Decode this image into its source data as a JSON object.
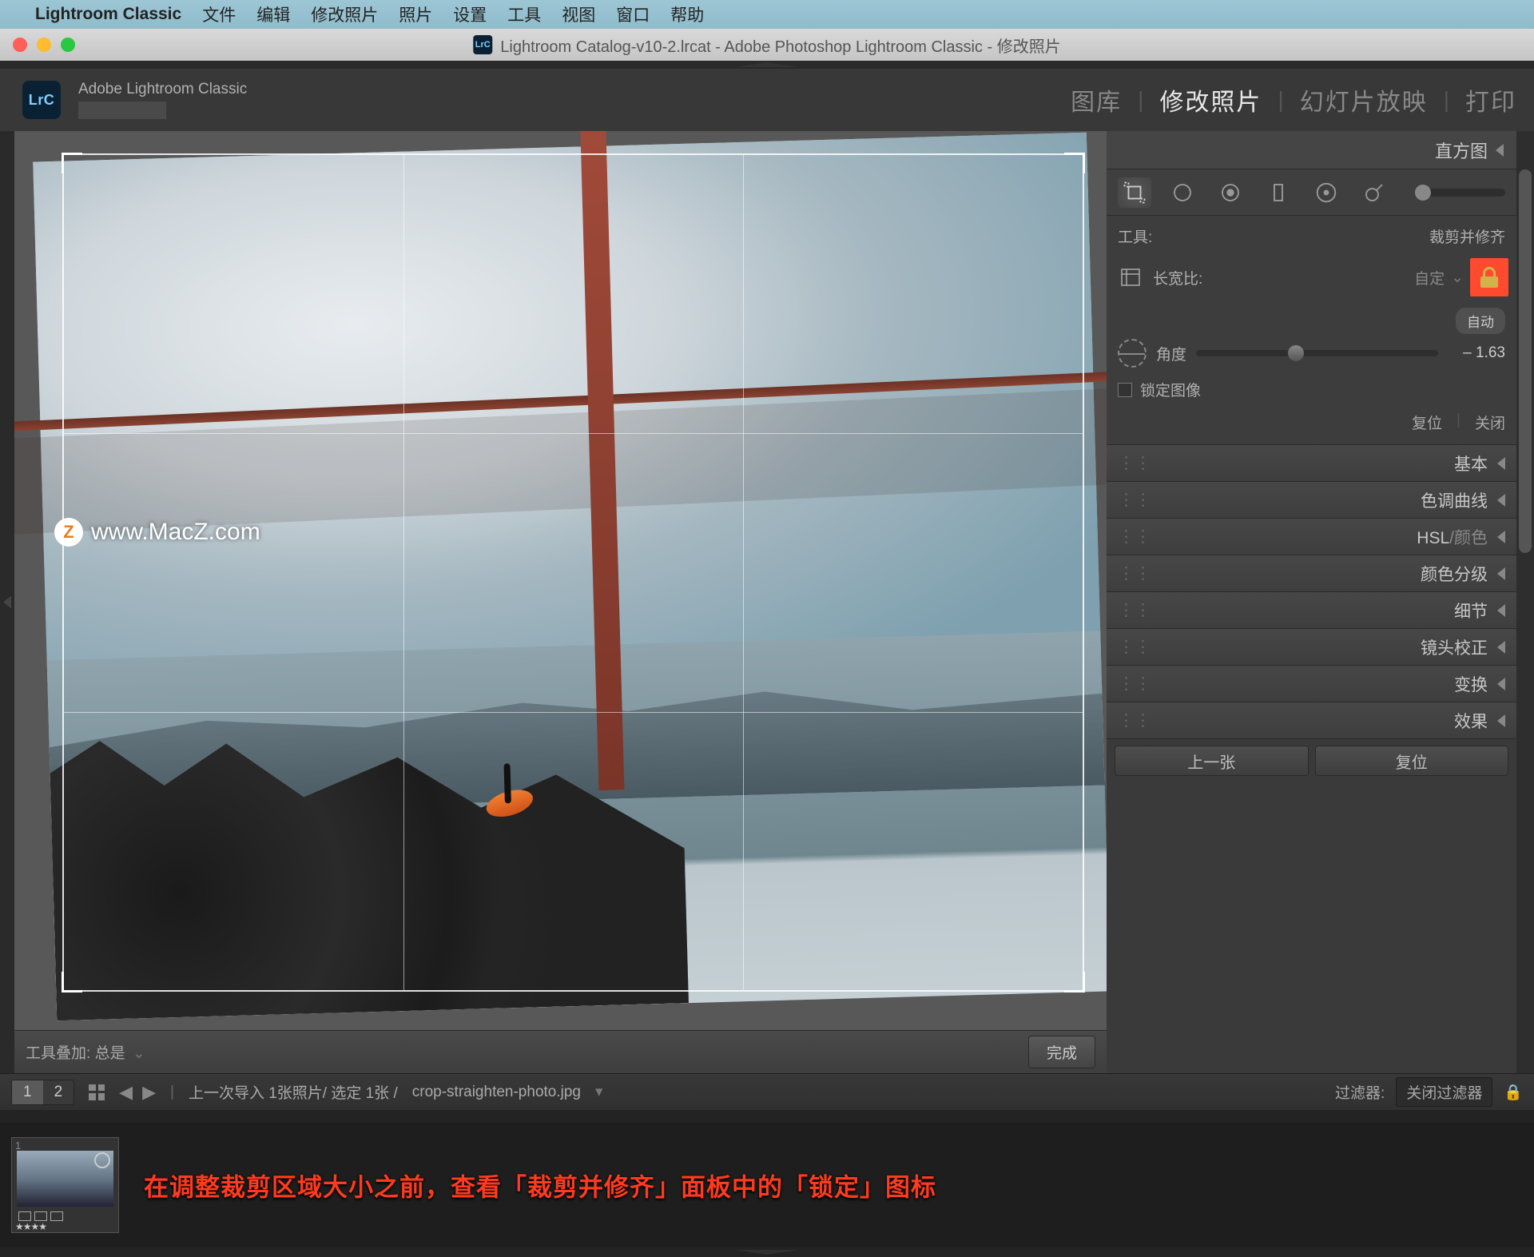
{
  "menubar": {
    "app": "Lightroom Classic",
    "items": [
      "文件",
      "编辑",
      "修改照片",
      "照片",
      "设置",
      "工具",
      "视图",
      "窗口",
      "帮助"
    ]
  },
  "titlebar": {
    "doc_icon": "LrC",
    "title": "Lightroom Catalog-v10-2.lrcat - Adobe Photoshop Lightroom Classic - 修改照片"
  },
  "header": {
    "brand_icon": "LrC",
    "brand_text": "Adobe Lightroom Classic",
    "modules": [
      "图库",
      "修改照片",
      "幻灯片放映",
      "打印"
    ],
    "active_module": "修改照片"
  },
  "center": {
    "watermark": "www.MacZ.com",
    "overlay_label": "工具叠加:",
    "overlay_value": "总是",
    "done": "完成"
  },
  "right": {
    "histogram": "直方图",
    "tool_label": "工具:",
    "tool_value": "裁剪并修齐",
    "aspect_label": "长宽比:",
    "aspect_value": "自定",
    "angle_label": "角度",
    "angle_auto": "自动",
    "angle_value": "– 1.63",
    "lock_image": "锁定图像",
    "reset": "复位",
    "close": "关闭",
    "panels": [
      {
        "label": "基本"
      },
      {
        "label": "色调曲线"
      },
      {
        "label": "HSL",
        "sub": "/颜色"
      },
      {
        "label": "颜色分级"
      },
      {
        "label": "细节"
      },
      {
        "label": "镜头校正"
      },
      {
        "label": "变换"
      },
      {
        "label": "效果"
      }
    ],
    "prev": "上一张",
    "reset2": "复位"
  },
  "strip": {
    "seg": [
      "1",
      "2"
    ],
    "info": "上一次导入   1张照片/ 选定 1张 /",
    "filename": "crop-straighten-photo.jpg",
    "filter_label": "过滤器:",
    "filter_value": "关闭过滤器"
  },
  "caption": "在调整裁剪区域大小之前，查看「裁剪并修齐」面板中的「锁定」图标"
}
